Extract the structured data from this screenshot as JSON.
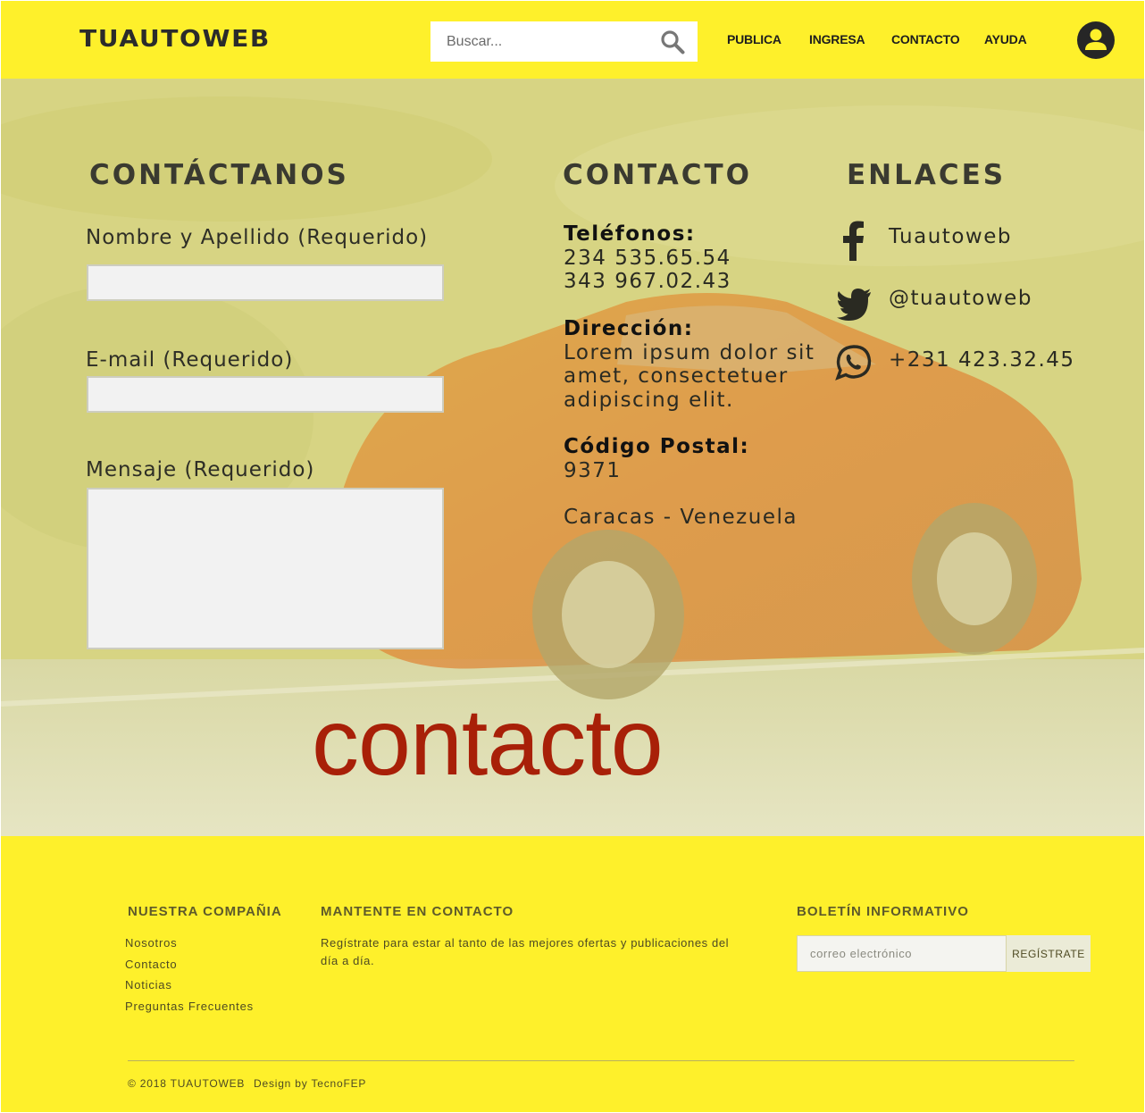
{
  "header": {
    "logo": "TUAUTOWEB",
    "search": {
      "placeholder": "Buscar..."
    },
    "nav": [
      "PUBLICA",
      "INGRESA",
      "CONTACTO",
      "AYUDA"
    ]
  },
  "hero": {
    "form": {
      "title": "CONTÁCTANOS",
      "name_label": "Nombre y Apellido (Requerido)",
      "email_label": "E-mail (Requerido)",
      "message_label": "Mensaje (Requerido)"
    },
    "contact": {
      "title": "CONTACTO",
      "phones_label": "Teléfonos:",
      "phones": [
        "234 535.65.54",
        "343 967.02.43"
      ],
      "address_label": "Dirección:",
      "address_lines": [
        "Lorem ipsum dolor sit",
        "amet, consectetuer",
        "adipiscing elit."
      ],
      "postal_label": "Código Postal:",
      "postal_code": "9371",
      "city": "Caracas - Venezuela"
    },
    "links": {
      "title": "ENLACES",
      "items": [
        {
          "icon": "facebook-icon",
          "label": "Tuautoweb"
        },
        {
          "icon": "twitter-icon",
          "label": "@tuautoweb"
        },
        {
          "icon": "whatsapp-icon",
          "label": "+231 423.32.45"
        }
      ]
    },
    "big_word": "contacto"
  },
  "footer": {
    "company": {
      "title": "NUESTRA COMPAÑIA",
      "links": [
        "Nosotros",
        "Contacto",
        "Noticias",
        "Preguntas Frecuentes"
      ]
    },
    "keep_in_touch": {
      "title": "MANTENTE EN CONTACTO",
      "text": "Regístrate para estar al tanto de las mejores ofertas y publicaciones del día a día."
    },
    "newsletter": {
      "title": "BOLETÍN INFORMATIVO",
      "placeholder": "correo electrónico",
      "button": "REGÍSTRATE"
    },
    "copyright": "© 2018 TUAUTOWEB",
    "credit": "Design by TecnoFEP"
  },
  "colors": {
    "brand_yellow": "#fef02b",
    "accent_red": "#a82008",
    "text_dark": "#2a2a22"
  }
}
